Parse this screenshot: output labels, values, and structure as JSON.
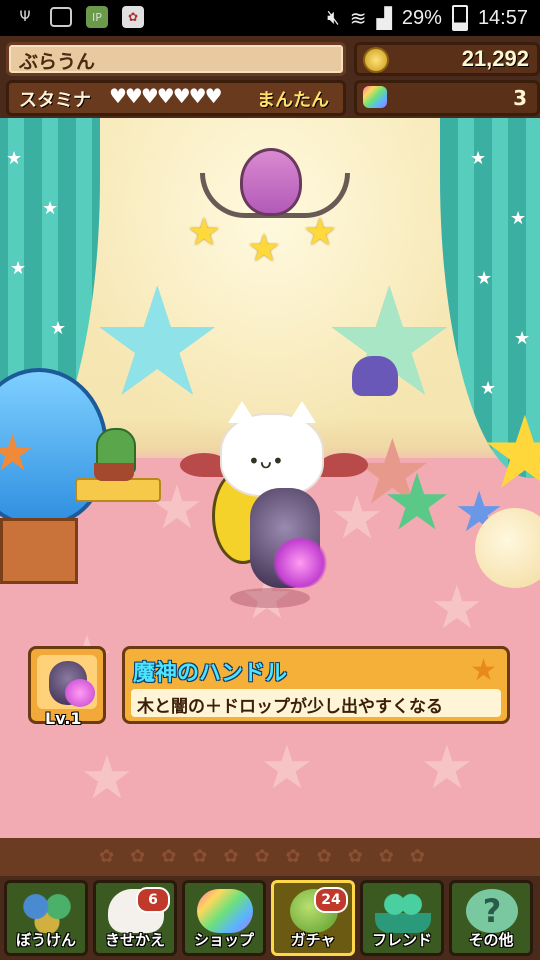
{
  "status_bar": {
    "battery": "29%",
    "time": "14:57",
    "icons": [
      "usb-icon",
      "image-icon",
      "ip-icon",
      "photo-icon",
      "mute-icon",
      "wifi-icon",
      "signal-icon",
      "battery-icon"
    ]
  },
  "header": {
    "player_name": "ぶらうん",
    "coins": "21,292",
    "stamina_label": "スタミナ",
    "stamina_hearts": "♥♥♥♥♥♥♥",
    "stamina_status": "まんたん",
    "magic_stones": "3"
  },
  "item": {
    "level": "Lv.1",
    "name": "魔神のハンドル",
    "description": "木と闇の＋ドロップが少し出やすくなる"
  },
  "nav": [
    {
      "label": "ぼうけん",
      "badge": "",
      "color": "#3a6a8a"
    },
    {
      "label": "きせかえ",
      "badge": "6",
      "color": "#9a6a3a"
    },
    {
      "label": "ショップ",
      "badge": "",
      "color": "#5a8a6a"
    },
    {
      "label": "ガチャ",
      "badge": "24",
      "color": "#6a8a3a"
    },
    {
      "label": "フレンド",
      "badge": "",
      "color": "#3a8a7a"
    },
    {
      "label": "その他",
      "badge": "",
      "color": "#7a6a3a"
    }
  ],
  "colors": {
    "accent": "#f5b03a",
    "title_text": "#4fe3ff",
    "header_bg": "#4a2a1a"
  }
}
